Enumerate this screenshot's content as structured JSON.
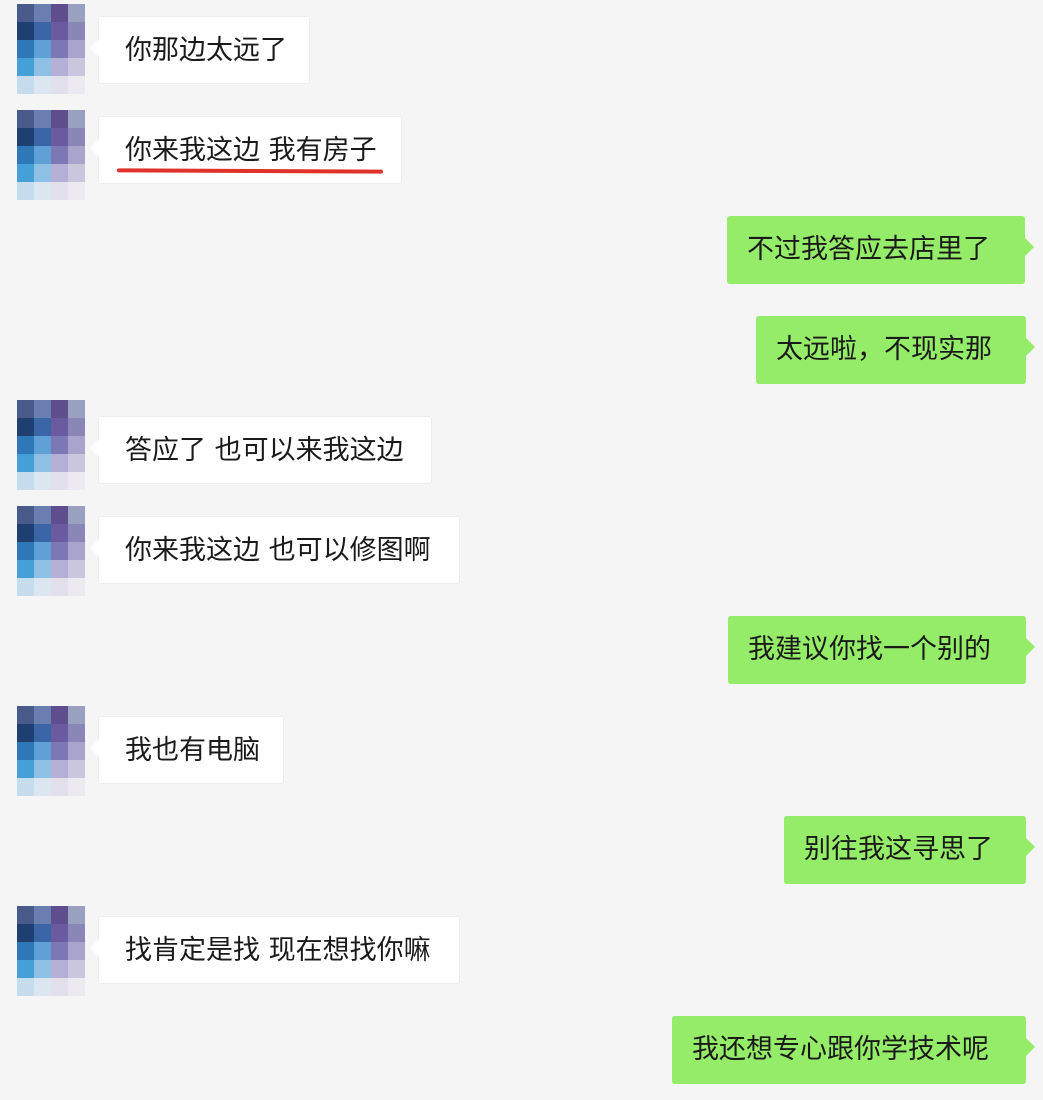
{
  "colors": {
    "background": "#f5f5f5",
    "incoming_bubble": "#ffffff",
    "outgoing_bubble": "#95ec69",
    "highlight_underline": "#e0322a"
  },
  "chat": {
    "messages": [
      {
        "side": "incoming",
        "text": "你那边太远了"
      },
      {
        "side": "incoming",
        "text": "你来我这边 我有房子",
        "underlined": true
      },
      {
        "side": "outgoing",
        "text": "不过我答应去店里了"
      },
      {
        "side": "outgoing",
        "text": "太远啦，不现实那"
      },
      {
        "side": "incoming",
        "text": "答应了 也可以来我这边"
      },
      {
        "side": "incoming",
        "text": "你来我这边 也可以修图啊"
      },
      {
        "side": "outgoing",
        "text": "我建议你找一个别的"
      },
      {
        "side": "incoming",
        "text": "我也有电脑"
      },
      {
        "side": "outgoing",
        "text": "别往我这寻思了"
      },
      {
        "side": "incoming",
        "text": "找肯定是找 现在想找你嘛"
      },
      {
        "side": "outgoing",
        "text": "我还想专心跟你学技术呢"
      }
    ]
  }
}
